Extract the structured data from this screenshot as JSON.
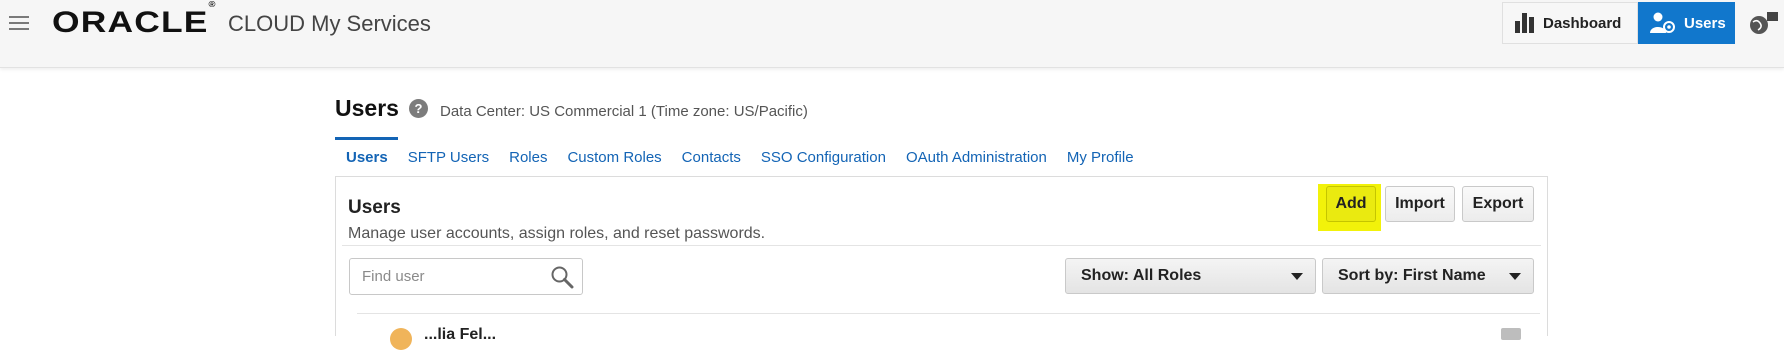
{
  "header": {
    "logo_text": "ORACLE",
    "logo_mark": "®",
    "title": "CLOUD My Services",
    "nav": {
      "dashboard_label": "Dashboard",
      "users_label": "Users"
    }
  },
  "page": {
    "title": "Users",
    "help_glyph": "?",
    "data_center": "Data Center: US Commercial 1 (Time zone: US/Pacific)"
  },
  "tabs": [
    {
      "label": "Users"
    },
    {
      "label": "SFTP Users"
    },
    {
      "label": "Roles"
    },
    {
      "label": "Custom Roles"
    },
    {
      "label": "Contacts"
    },
    {
      "label": "SSO Configuration"
    },
    {
      "label": "OAuth Administration"
    },
    {
      "label": "My Profile"
    }
  ],
  "panel": {
    "title": "Users",
    "description": "Manage user accounts, assign roles, and reset passwords.",
    "add_label": "Add",
    "import_label": "Import",
    "export_label": "Export",
    "search_placeholder": "Find user",
    "show_filter": "Show: All Roles",
    "sort_filter": "Sort by: First Name"
  },
  "list": {
    "first_row_name": "...lia Fel..."
  },
  "colors": {
    "accent": "#1177cc",
    "link": "#1364b5",
    "highlight": "#f2f20a"
  }
}
